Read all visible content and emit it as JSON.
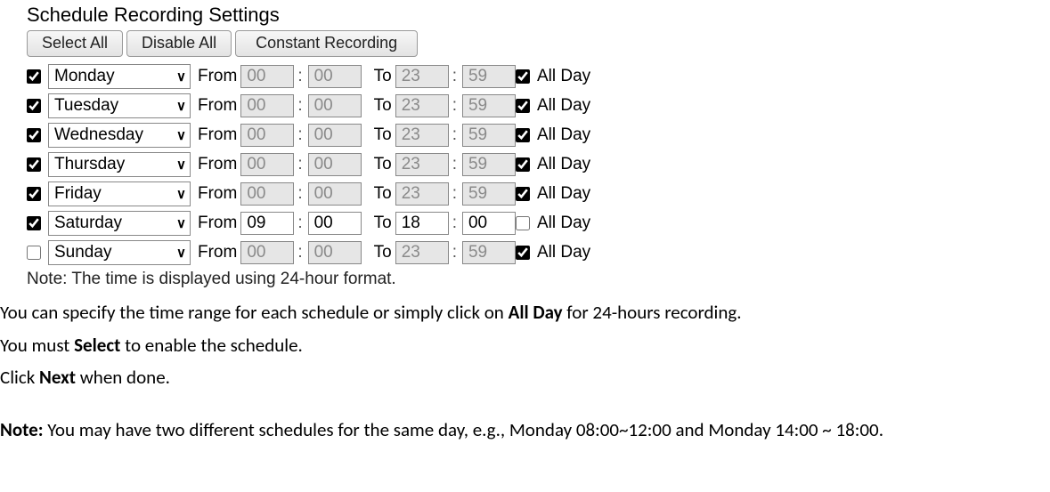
{
  "panel": {
    "title": "Schedule Recording Settings",
    "buttons": {
      "select_all": "Select All",
      "disable_all": "Disable All",
      "constant": "Constant Recording"
    },
    "labels": {
      "from": "From",
      "to": "To",
      "all_day": "All Day",
      "colon": ":"
    },
    "rows": [
      {
        "enabled": true,
        "day": "Monday",
        "from_h": "00",
        "from_m": "00",
        "to_h": "23",
        "to_m": "59",
        "all_day": true,
        "editable": false
      },
      {
        "enabled": true,
        "day": "Tuesday",
        "from_h": "00",
        "from_m": "00",
        "to_h": "23",
        "to_m": "59",
        "all_day": true,
        "editable": false
      },
      {
        "enabled": true,
        "day": "Wednesday",
        "from_h": "00",
        "from_m": "00",
        "to_h": "23",
        "to_m": "59",
        "all_day": true,
        "editable": false
      },
      {
        "enabled": true,
        "day": "Thursday",
        "from_h": "00",
        "from_m": "00",
        "to_h": "23",
        "to_m": "59",
        "all_day": true,
        "editable": false
      },
      {
        "enabled": true,
        "day": "Friday",
        "from_h": "00",
        "from_m": "00",
        "to_h": "23",
        "to_m": "59",
        "all_day": true,
        "editable": false
      },
      {
        "enabled": true,
        "day": "Saturday",
        "from_h": "09",
        "from_m": "00",
        "to_h": "18",
        "to_m": "00",
        "all_day": false,
        "editable": true
      },
      {
        "enabled": false,
        "day": "Sunday",
        "from_h": "00",
        "from_m": "00",
        "to_h": "23",
        "to_m": "59",
        "all_day": true,
        "editable": false
      }
    ],
    "note": "Note: The time is displayed using 24-hour format."
  },
  "doc": {
    "p1_a": "You can specify the time range for each schedule or simply click on ",
    "p1_b": "All Day",
    "p1_c": " for 24-hours recording.",
    "p2_a": "You must ",
    "p2_b": "Select",
    "p2_c": " to enable the schedule.",
    "p3_a": "Click ",
    "p3_b": "Next",
    "p3_c": " when done.",
    "p4_a": "Note:",
    "p4_b": " You may have two different schedules for the same day, e.g., Monday 08:00~12:00 and Monday 14:00 ~ 18:00."
  }
}
